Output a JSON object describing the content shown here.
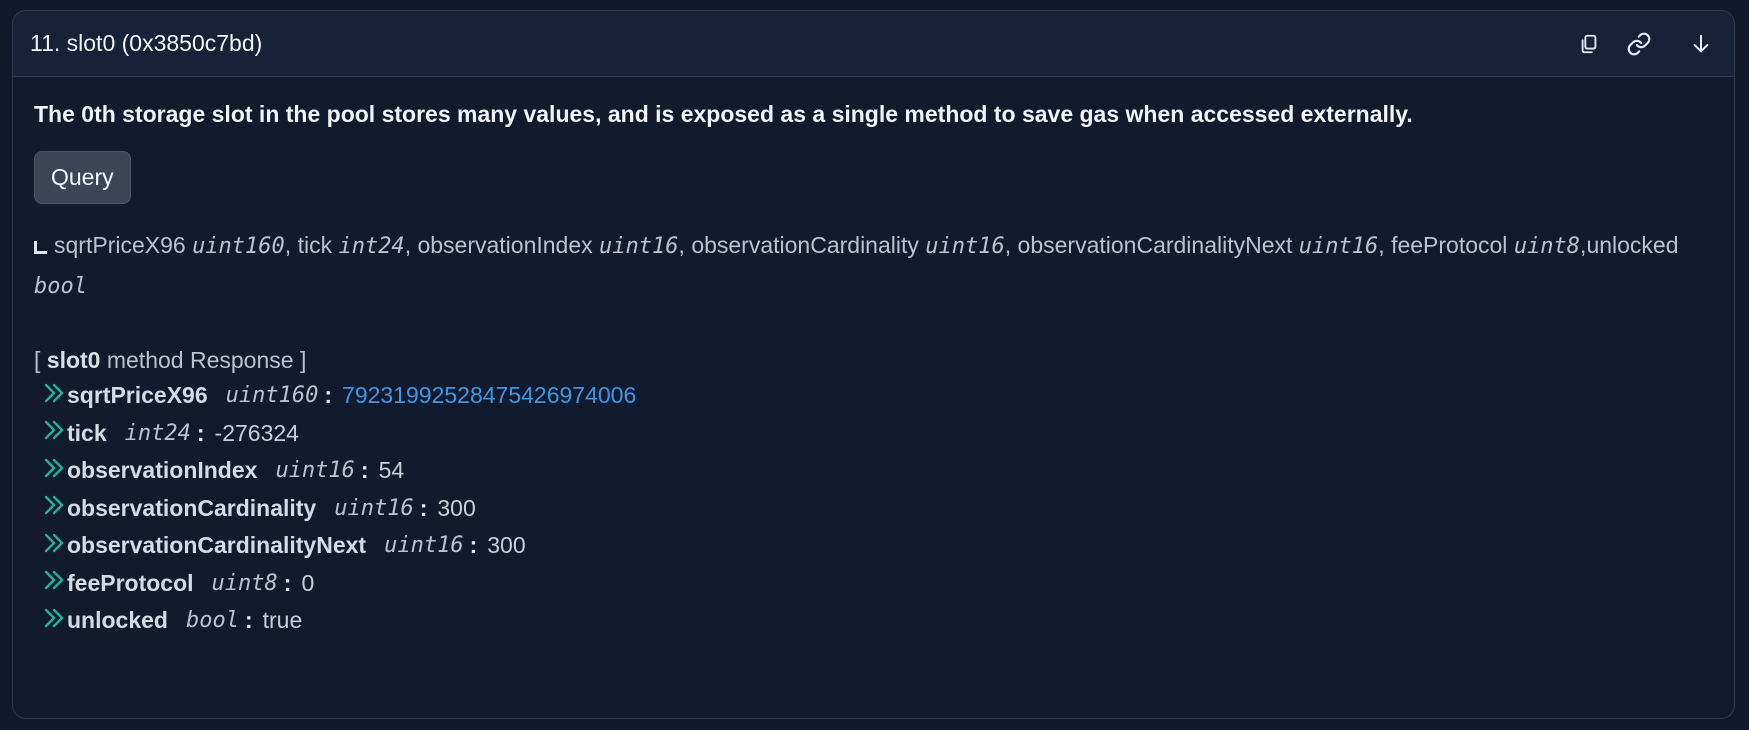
{
  "header": {
    "title": "11. slot0 (0x3850c7bd)",
    "actions": [
      "copy-icon",
      "link-icon",
      "arrow-down-icon"
    ]
  },
  "description": "The 0th storage slot in the pool stores many values, and is exposed as a single method to save gas when accessed externally.",
  "query_button": "Query",
  "signature": [
    {
      "name": "sqrtPriceX96",
      "type": "uint160",
      "sep": ", "
    },
    {
      "name": "tick",
      "type": "int24",
      "sep": ", "
    },
    {
      "name": "observationIndex",
      "type": "uint16",
      "sep": ", "
    },
    {
      "name": "observationCardinality",
      "type": "uint16",
      "sep": ", "
    },
    {
      "name": "observationCardinalityNext",
      "type": "uint16",
      "sep": ", "
    },
    {
      "name": "feeProtocol",
      "type": "uint8",
      "sep": ","
    },
    {
      "name": "unlocked",
      "type": "bool",
      "sep": ""
    }
  ],
  "response": {
    "open": "[",
    "method": "slot0",
    "label": "method Response",
    "close": "]",
    "rows": [
      {
        "name": "sqrtPriceX96",
        "type": "uint160",
        "value": "79231992528475426974006",
        "link": true
      },
      {
        "name": "tick",
        "type": "int24",
        "value": "-276324",
        "link": false
      },
      {
        "name": "observationIndex",
        "type": "uint16",
        "value": "54",
        "link": false
      },
      {
        "name": "observationCardinality",
        "type": "uint16",
        "value": "300",
        "link": false
      },
      {
        "name": "observationCardinalityNext",
        "type": "uint16",
        "value": "300",
        "link": false
      },
      {
        "name": "feeProtocol",
        "type": "uint8",
        "value": "0",
        "link": false
      },
      {
        "name": "unlocked",
        "type": "bool",
        "value": "true",
        "link": false
      }
    ]
  },
  "colors": {
    "background": "#111a2c",
    "header": "#172138",
    "chevron": "#1fb39a",
    "link": "#3f97e3"
  }
}
